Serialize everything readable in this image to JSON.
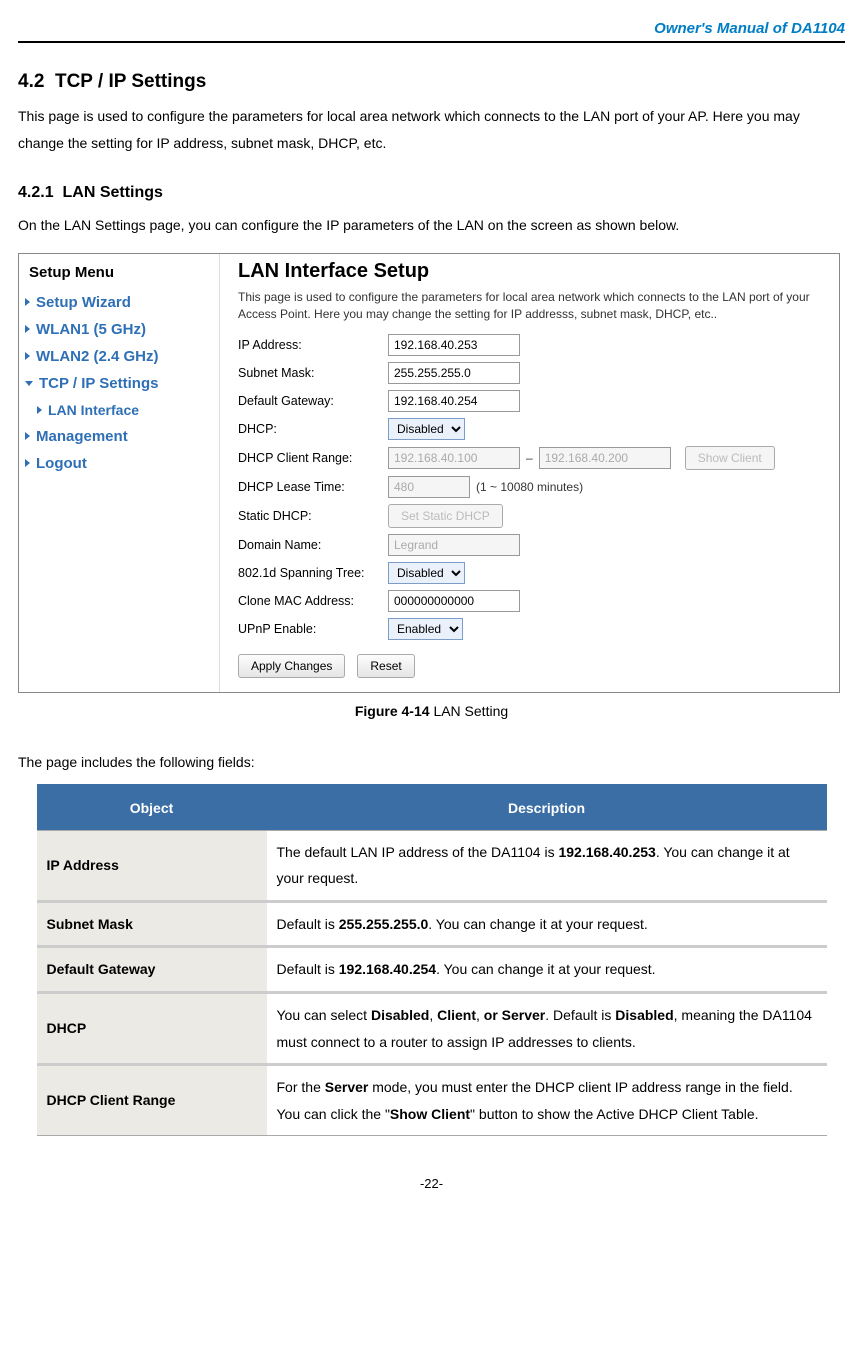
{
  "page": {
    "header": "Owner's Manual of DA1104",
    "sectionNumber": "4.2",
    "sectionTitle": "TCP / IP Settings",
    "sectionBody": "This page is used to configure the parameters for local area network which connects to the LAN port of your AP. Here you may change the setting for IP address, subnet mask, DHCP, etc.",
    "subsectionNumber": "4.2.1",
    "subsectionTitle": "LAN Settings",
    "subsectionBody": "On the LAN Settings page, you can configure the IP parameters of the LAN on the screen as shown below.",
    "figureLabel": "Figure 4-14",
    "figureName": "LAN Setting",
    "fieldsIntro": "The page includes the following fields:",
    "pageNumber": "-22-"
  },
  "screenshot": {
    "menu": {
      "title": "Setup Menu",
      "items": [
        "Setup Wizard",
        "WLAN1 (5 GHz)",
        "WLAN2 (2.4 GHz)",
        "TCP / IP Settings",
        "LAN Interface",
        "Management",
        "Logout"
      ]
    },
    "panel": {
      "title": "LAN Interface Setup",
      "desc": "This page is used to configure the parameters for local area network which connects to the LAN port of your Access Point. Here you may change the setting for IP addresss, subnet mask, DHCP, etc..",
      "labels": {
        "ip": "IP Address:",
        "subnet": "Subnet Mask:",
        "gateway": "Default Gateway:",
        "dhcp": "DHCP:",
        "range": "DHCP Client Range:",
        "lease": "DHCP Lease Time:",
        "leaseHint": "(1 ~ 10080 minutes)",
        "staticDhcp": "Static DHCP:",
        "domain": "Domain Name:",
        "spanning": "802.1d Spanning Tree:",
        "clone": "Clone MAC Address:",
        "upnp": "UPnP Enable:"
      },
      "values": {
        "ip": "192.168.40.253",
        "subnet": "255.255.255.0",
        "gateway": "192.168.40.254",
        "dhcp": "Disabled",
        "rangeStart": "192.168.40.100",
        "rangeEnd": "192.168.40.200",
        "lease": "480",
        "domain": "Legrand",
        "spanning": "Disabled",
        "clone": "000000000000",
        "upnp": "Enabled"
      },
      "buttons": {
        "showClient": "Show Client",
        "setStatic": "Set Static DHCP",
        "apply": "Apply Changes",
        "reset": "Reset"
      }
    }
  },
  "table": {
    "headers": {
      "object": "Object",
      "description": "Description"
    },
    "rows": [
      {
        "obj": "IP Address",
        "desc": "The default LAN IP address of the DA1104 is <strong>192.168.40.253</strong>. You can change it at   your request."
      },
      {
        "obj": "Subnet Mask",
        "desc": "Default is <strong>255.255.255.0</strong>. You can change it at your request."
      },
      {
        "obj": "Default Gateway",
        "desc": "Default is <strong>192.168.40.254</strong>. You can change it at your request."
      },
      {
        "obj": "DHCP",
        "desc": "You can select <strong>Disabled</strong>, <strong>Client</strong>, <strong>or Server</strong>. Default is <strong>Disabled</strong>, meaning the DA1104 must connect to a router to assign IP addresses to clients."
      },
      {
        "obj": "DHCP Client Range",
        "desc": "For the <strong>Server</strong> mode, you must enter the DHCP client IP address range in the field. You can click the \"<strong>Show Client</strong>\" button to show the Active DHCP Client Table."
      }
    ]
  }
}
